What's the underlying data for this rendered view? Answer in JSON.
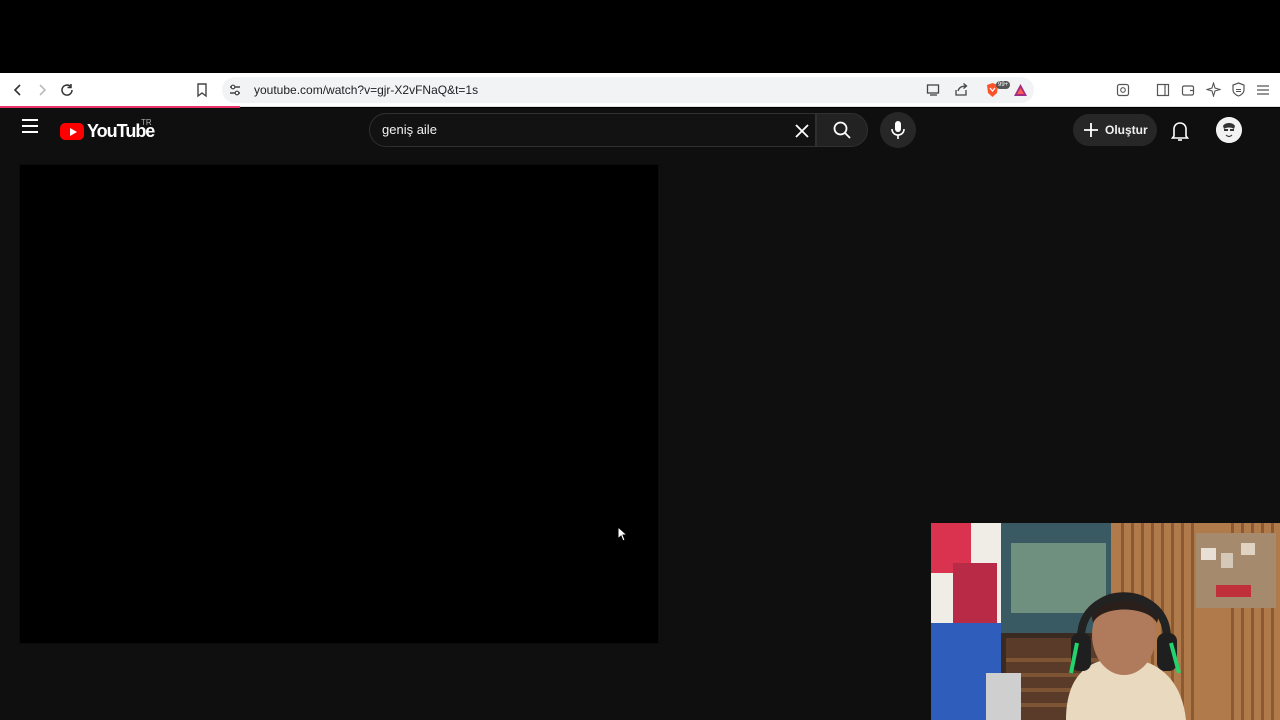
{
  "browser": {
    "url": "youtube.com/watch?v=gjr-X2vFNaQ&t=1s",
    "extension_badge": "99+",
    "icons": [
      "back-icon",
      "forward-icon",
      "reload-icon",
      "bookmark-icon",
      "site-settings-icon",
      "cast-icon",
      "share-icon",
      "brave-shields-icon",
      "brave-rewards-icon",
      "reader-icon",
      "sidebar-icon",
      "wallet-icon",
      "leo-icon",
      "vpn-icon",
      "menu-icon"
    ]
  },
  "youtube": {
    "logo_text": "YouTube",
    "region": "TR",
    "search": {
      "value": "geniş aile"
    },
    "create_label": "Oluştur",
    "colors": {
      "brand_red": "#ff0000",
      "background": "#0f0f0f"
    }
  }
}
